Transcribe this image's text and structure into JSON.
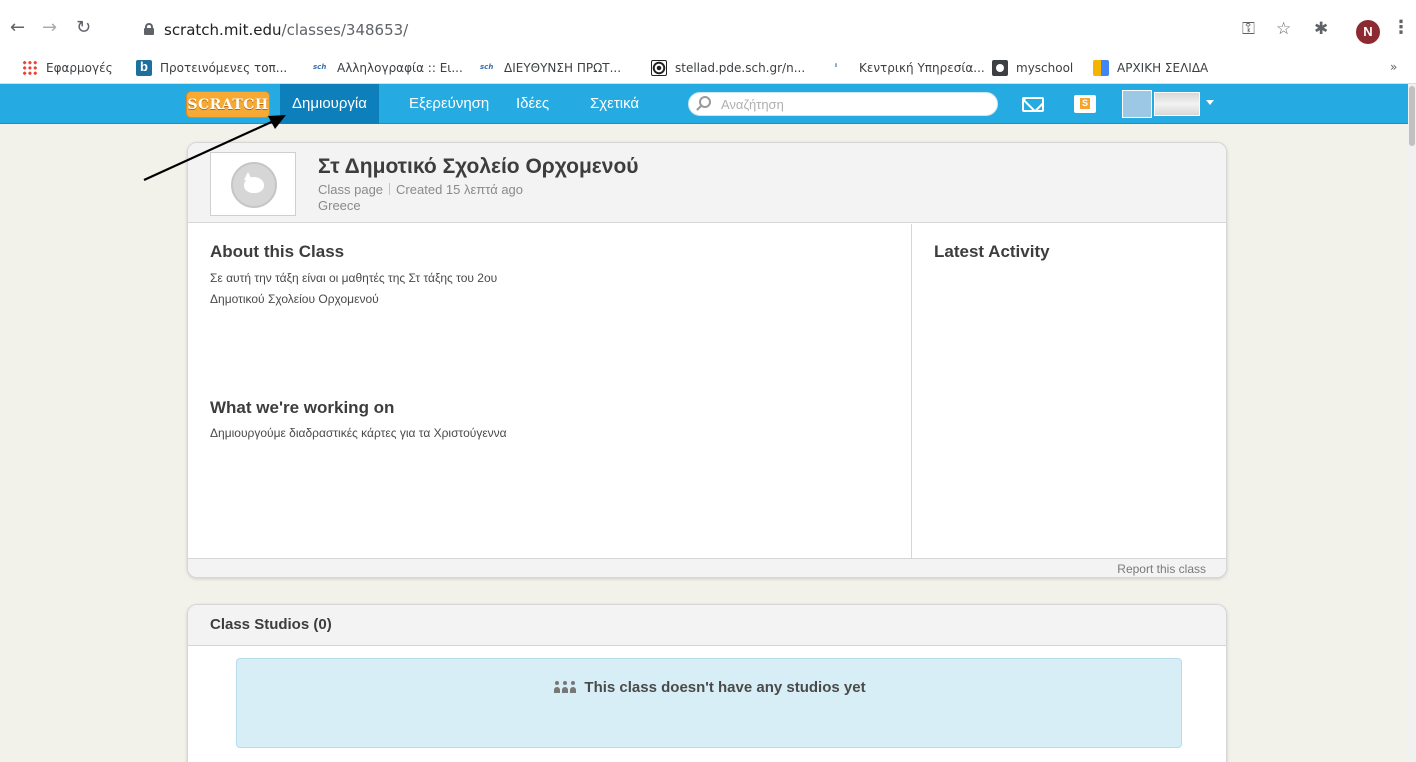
{
  "browser": {
    "url_host": "scratch.mit.edu",
    "url_path": "/classes/348653/",
    "profile_initial": "N",
    "more_bookmarks": "»",
    "bookmarks": [
      {
        "label": "Εφαρμογές",
        "icon": "apps-icon"
      },
      {
        "label": "Προτεινόμενες τοπ...",
        "icon": "bing-icon"
      },
      {
        "label": "Αλληλογραφία :: Ει...",
        "icon": "sch-icon"
      },
      {
        "label": "ΔΙΕΥΘΥΝΣΗ ΠΡΩΤ...",
        "icon": "sch-icon"
      },
      {
        "label": "stellad.pde.sch.gr/n...",
        "icon": "target-icon"
      },
      {
        "label": "Κεντρική Υπηρεσία...",
        "icon": "logo-icon"
      },
      {
        "label": "myschool",
        "icon": "globe-icon"
      },
      {
        "label": "ΑΡΧΙΚΗ ΣΕΛΙΔΑ",
        "icon": "book-icon"
      }
    ]
  },
  "nav": {
    "logo": "SCRATCH",
    "links": [
      "Δημιουργία",
      "Εξερεύνηση",
      "Ιδέες",
      "Σχετικά"
    ],
    "search_placeholder": "Αναζήτηση"
  },
  "class": {
    "title": "Στ Δημοτικό Σχολείο Ορχομενού",
    "type": "Class page",
    "created": "Created 15 λεπτά ago",
    "country": "Greece",
    "about_title": "About this Class",
    "about_text": "Σε αυτή την τάξη είναι οι μαθητές της Στ τάξης του 2ου Δημοτικού Σχολείου Ορχομενού",
    "working_title": "What we're working on",
    "working_text": "Δημιουργούμε διαδραστικές κάρτες για τα Χριστούγεννα",
    "activity_title": "Latest Activity",
    "report": "Report this class"
  },
  "studios": {
    "title": "Class Studios (0)",
    "empty": "This class doesn't have any studios yet"
  },
  "colors": {
    "nav_bg": "#25aae1",
    "nav_active": "#0d7fbb",
    "logo_bg": "#f7a934",
    "empty_bg": "#d8eef7"
  }
}
